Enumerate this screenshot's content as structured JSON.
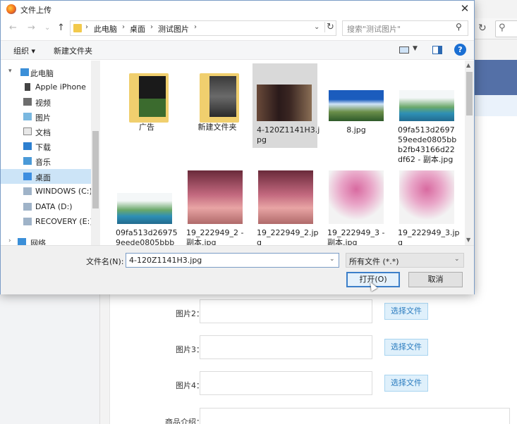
{
  "dialog": {
    "title": "文件上传",
    "close": "✕"
  },
  "nav": {
    "back": "←",
    "forward": "→",
    "recent": "⌄",
    "up": "↑",
    "breadcrumbs": [
      "此电脑",
      "桌面",
      "测试图片"
    ],
    "search_placeholder": "搜索\"测试图片\""
  },
  "toolbar": {
    "organize": "组织 ▾",
    "new_folder": "新建文件夹",
    "help": "?"
  },
  "sidebar": {
    "items": [
      {
        "label": "此电脑",
        "icon": "computer-icon"
      },
      {
        "label": "Apple iPhone",
        "icon": "phone-icon"
      },
      {
        "label": "视频",
        "icon": "video-folder-icon"
      },
      {
        "label": "图片",
        "icon": "pictures-folder-icon"
      },
      {
        "label": "文档",
        "icon": "documents-folder-icon"
      },
      {
        "label": "下载",
        "icon": "download-folder-icon"
      },
      {
        "label": "音乐",
        "icon": "music-folder-icon"
      },
      {
        "label": "桌面",
        "icon": "desktop-folder-icon"
      },
      {
        "label": "WINDOWS (C:)",
        "icon": "drive-icon"
      },
      {
        "label": "DATA (D:)",
        "icon": "drive-icon"
      },
      {
        "label": "RECOVERY (E:)",
        "icon": "drive-icon"
      },
      {
        "label": "网络",
        "icon": "network-icon"
      }
    ]
  },
  "files": [
    {
      "name": "广告",
      "kind": "folder"
    },
    {
      "name": "新建文件夹",
      "kind": "folder"
    },
    {
      "name": "4-120Z1141H3.jpg",
      "kind": "image"
    },
    {
      "name": "8.jpg",
      "kind": "image"
    },
    {
      "name": "09fa513d269759eede0805bbb2fb43166d22df62 - 副本.jpg",
      "kind": "image"
    },
    {
      "name": "09fa513d269759eede0805bbb",
      "kind": "image"
    },
    {
      "name": "19_222949_2 - 副本.jpg",
      "kind": "image"
    },
    {
      "name": "19_222949_2.jpg",
      "kind": "image"
    },
    {
      "name": "19_222949_3 - 副本.jpg",
      "kind": "image"
    },
    {
      "name": "19_222949_3.jpg",
      "kind": "image"
    }
  ],
  "bottom": {
    "filename_label": "文件名(N):",
    "filename_value": "4-120Z1141H3.jpg",
    "filetype": "所有文件 (*.*)",
    "open": "打开(O)",
    "cancel": "取消"
  },
  "page": {
    "rows": [
      {
        "label": "图片2：",
        "button": "选择文件"
      },
      {
        "label": "图片3：",
        "button": "选择文件"
      },
      {
        "label": "图片4：",
        "button": "选择文件"
      },
      {
        "label": "商品介绍："
      }
    ]
  }
}
